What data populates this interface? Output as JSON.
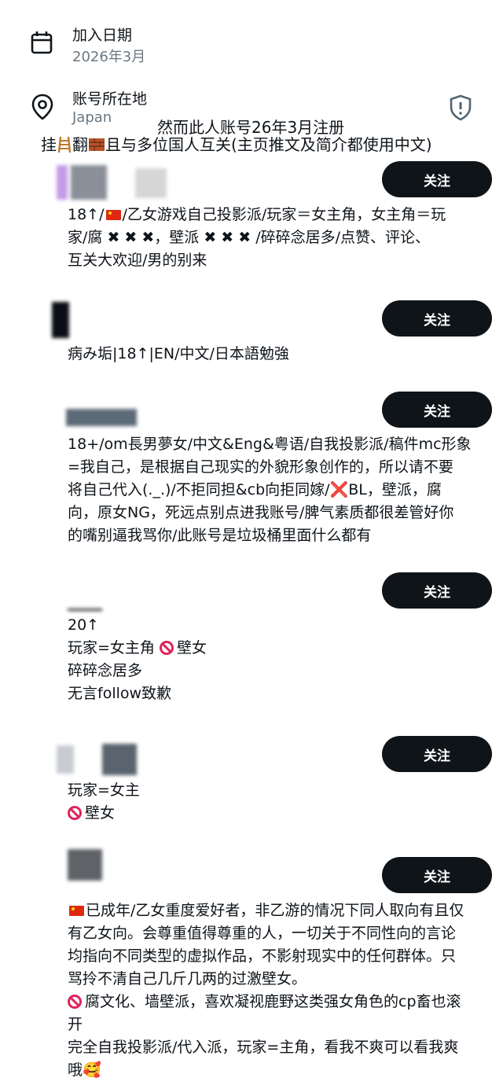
{
  "profile_meta": {
    "join_label": "加入日期",
    "join_value": "2026年3月",
    "location_label": "账号所在地",
    "location_value": "Japan"
  },
  "overlay": {
    "line1": "然而此人账号26年3月注册",
    "line2_a": "挂",
    "line2_b": "翻",
    "line2_c": "且与多位国人互关(主页推文及简介都使用中文)"
  },
  "follow_label": "关注",
  "users": [
    {
      "bio_lines": [
        [
          "18↑/",
          "[flag]",
          "/乙女游戏自己投影派/玩家＝女主角，女主角＝玩"
        ],
        [
          "家/腐 ✖ ✖ ✖，壁派 ✖ ✖ ✖ /碎碎念居多/点赞、评论、"
        ],
        [
          "互关大欢迎/男的别来"
        ]
      ]
    },
    {
      "bio_lines": [
        [
          "病み垢|18↑|EN/中文/日本語勉強"
        ]
      ]
    },
    {
      "bio_lines": [
        [
          "18+/om長男夢女/中文&Eng&粤语/自我投影派/稿件mc形象"
        ],
        [
          "=我自己，是根据自己现实的外貌形象创作的，所以请不要"
        ],
        [
          "将自己代入(._.)/不拒同担&cb向拒同嫁/",
          "❌",
          "BL，壁派，腐"
        ],
        [
          "向，原女NG，死远点别点进我账号/脾气素质都很差管好你"
        ],
        [
          "的嘴别逼我骂你/此账号是垃圾桶里面什么都有"
        ]
      ]
    },
    {
      "bio_lines": [
        [
          "20↑"
        ],
        [
          "玩家=女主角 ",
          "[no]",
          "壁女"
        ],
        [
          "碎碎念居多"
        ],
        [
          "无言follow致歉"
        ]
      ]
    },
    {
      "bio_lines": [
        [
          "玩家=女主"
        ],
        [
          "[no]",
          "壁女"
        ]
      ]
    },
    {
      "bio_lines": [
        [
          "[flag]",
          "已成年/乙女重度爱好者，非乙游的情况下同人取向有且仅"
        ],
        [
          "有乙女向。会尊重值得尊重的人，一切关于不同性向的言论"
        ],
        [
          "均指向不同类型的虚拟作品，不影射现实中的任何群体。只"
        ],
        [
          "骂拎不清自己几斤几两的过激壁女。"
        ],
        [
          "[no]",
          "腐文化、墙壁派，喜欢凝视鹿野这类强女角色的cp畜也滚"
        ],
        [
          "开"
        ],
        [
          "完全自我投影派/代入派，玩家=主角，看我不爽可以看我爽"
        ],
        [
          "哦",
          "🥰"
        ]
      ]
    }
  ]
}
